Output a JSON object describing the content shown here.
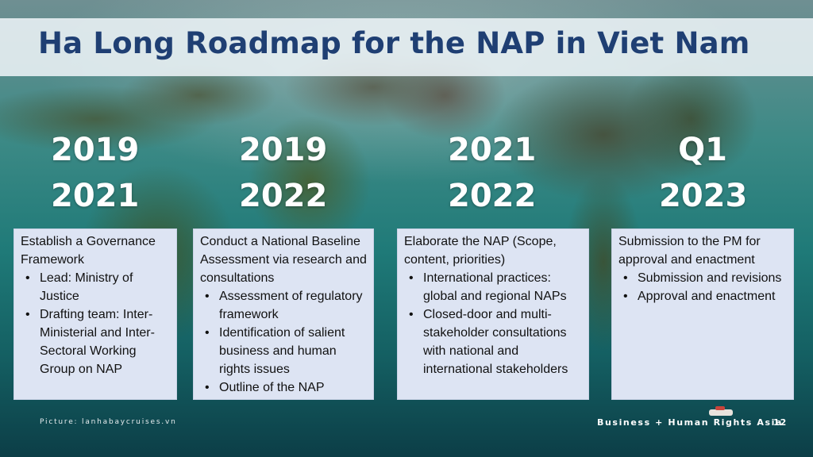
{
  "title": "Ha Long Roadmap for the NAP in Viet Nam",
  "milestones": [
    {
      "date_line1": "2019",
      "date_line2": "2021",
      "heading": "Establish a Governance Framework",
      "bullets": [
        "Lead: Ministry of Justice",
        "Drafting team: Inter-Ministerial and Inter-Sectoral Working Group on NAP"
      ]
    },
    {
      "date_line1": "2019",
      "date_line2": "2022",
      "heading": "Conduct a National Baseline Assessment via research and consultations",
      "bullets": [
        "Assessment of regulatory framework",
        "Identification of salient business and human rights issues",
        "Outline of the NAP"
      ]
    },
    {
      "date_line1": "2021",
      "date_line2": "2022",
      "heading": "Elaborate the NAP (Scope, content, priorities)",
      "bullets": [
        "International practices: global and regional NAPs",
        "Closed-door and multi-stakeholder consultations with national and international stakeholders"
      ]
    },
    {
      "date_line1": "Q1",
      "date_line2": "2023",
      "heading": "Submission to the PM for approval and enactment",
      "bullets": [
        "Submission and revisions",
        "Approval and enactment"
      ]
    }
  ],
  "footer": {
    "picture_credit": "Picture: lanhabaycruises.vn",
    "brand": "Business + Human Rights Asia",
    "page_number": "12"
  }
}
